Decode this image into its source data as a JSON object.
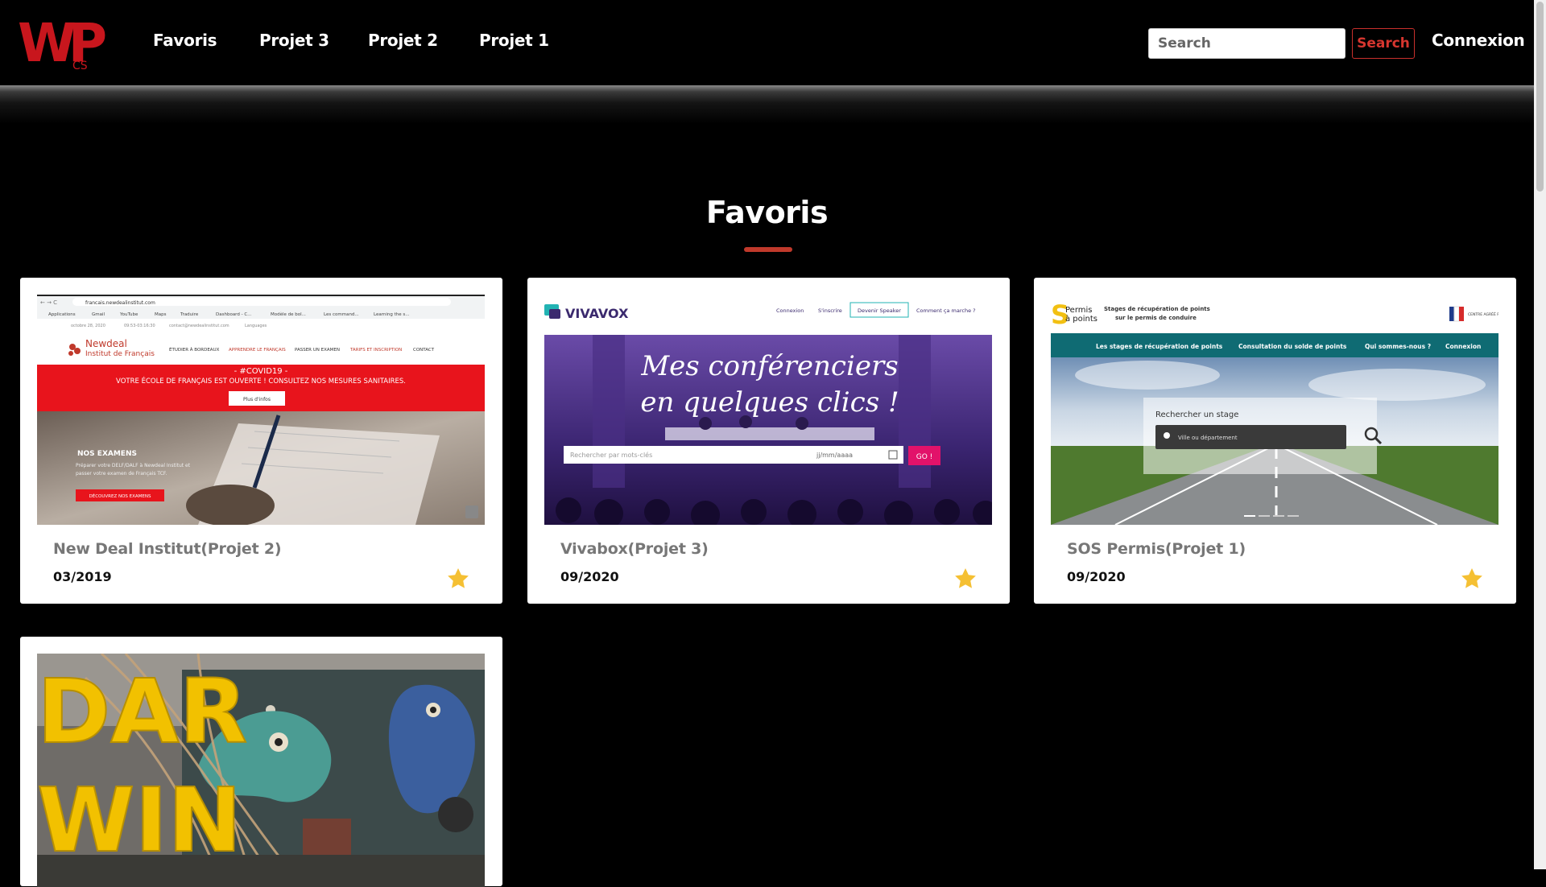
{
  "brand": {
    "letters": "WP",
    "sub": "CS",
    "color": "#c8161d"
  },
  "nav": {
    "links": [
      "Favoris",
      "Projet 3",
      "Projet 2",
      "Projet 1"
    ],
    "search_placeholder": "Search",
    "search_button": "Search",
    "login": "Connexion"
  },
  "main": {
    "title": "Favoris"
  },
  "cards": [
    {
      "title": "New Deal Institut(Projet 2)",
      "date": "03/2019",
      "favorite": true,
      "preview": {
        "url": "francais.newdealinstitut.com",
        "bookmarks": [
          "Applications",
          "Gmail",
          "YouTube",
          "Maps",
          "Traduire",
          "Dashboard - C...",
          "Modèle de bol...",
          "Les command...",
          "Learning the s..."
        ],
        "topbar_date": "octobre 28, 2020",
        "topbar_hours": "09:53-03:16:30",
        "topbar_email": "contact@newdealinstitut.com",
        "topbar_lang": "Languages",
        "logo_line1": "Newdeal",
        "logo_line2": "Institut de Français",
        "menu": [
          "ÉTUDIER À BORDEAUX",
          "APPRENDRE LE FRANÇAIS",
          "PASSER UN EXAMEN",
          "TARIFS ET INSCRIPTION",
          "CONTACT"
        ],
        "banner_title": "- #COVID19 -",
        "banner_text": "VOTRE ÉCOLE DE FRANÇAIS EST OUVERTE ! CONSULTEZ NOS MESURES SANITAIRES.",
        "banner_button": "Plus d'infos",
        "exam_title": "NOS EXAMENS",
        "exam_line1": "Préparer votre DELF/DALF à Newdeal Institut et",
        "exam_line2": "passer votre examen de Français TCF.",
        "exam_button": "DÉCOUVREZ NOS EXAMENS"
      }
    },
    {
      "title": "Vivabox(Projet 3)",
      "date": "09/2020",
      "favorite": true,
      "preview": {
        "logo": "VIVAVOX",
        "menu": [
          "Connexion",
          "S'inscrire",
          "Devenir Speaker",
          "Comment ça marche ?"
        ],
        "hero_line1": "Mes conférenciers",
        "hero_line2": "en quelques clics !",
        "search_placeholder": "Rechercher par mots-clés",
        "date_placeholder": "jj/mm/aaaa",
        "go": "GO !"
      }
    },
    {
      "title": "SOS Permis(Projet 1)",
      "date": "09/2020",
      "favorite": true,
      "preview": {
        "logo_line1": "Permis",
        "logo_line2": "à points",
        "tagline1": "Stages de récupération de points",
        "tagline2": "sur le permis de conduire",
        "badge": "CENTRE AGRÉÉ PAR LES PRÉFECTURES",
        "menu": [
          "Les stages de récupération de points",
          "Consultation du solde de points",
          "Qui sommes-nous ?",
          "Connexion"
        ],
        "search_label": "Rechercher un stage",
        "search_placeholder": "Ville ou département"
      }
    },
    {
      "title": "",
      "date": "",
      "favorite": false,
      "preview": {
        "sign_top": "DAR",
        "sign_bottom": "WIN"
      }
    }
  ]
}
